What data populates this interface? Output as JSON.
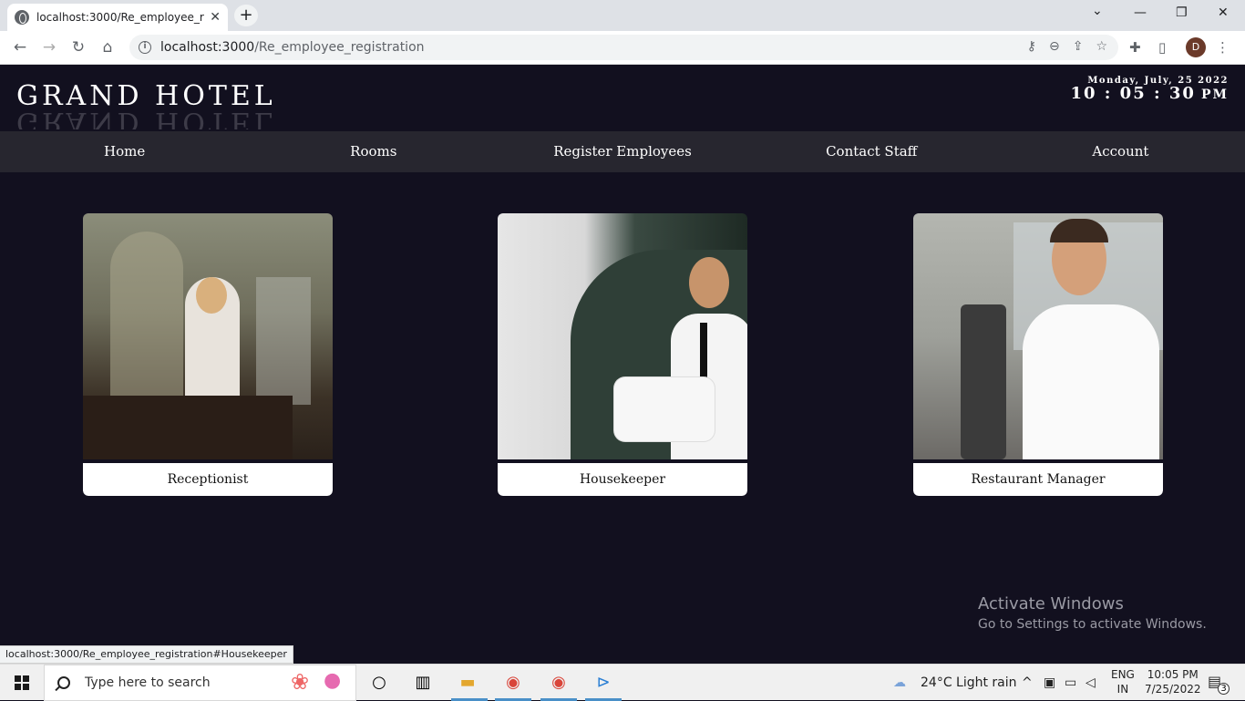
{
  "browser": {
    "tab_title": "localhost:3000/Re_employee_reg",
    "tab_close": "✕",
    "new_tab": "+",
    "url_host": "localhost:3000",
    "url_path": "/Re_employee_registration",
    "avatar_letter": "D",
    "minimize": "—",
    "restore": "❐",
    "close": "✕",
    "chevron": "⌄"
  },
  "site": {
    "brand": "GRAND HOTEL",
    "date": "Monday, July, 25 2022",
    "time": "10 : 05 : 30",
    "ampm": "PM"
  },
  "nav": [
    {
      "label": "Home"
    },
    {
      "label": "Rooms"
    },
    {
      "label": "Register Employees"
    },
    {
      "label": "Contact Staff"
    },
    {
      "label": "Account"
    }
  ],
  "cards": [
    {
      "label": "Receptionist"
    },
    {
      "label": "Housekeeper"
    },
    {
      "label": "Restaurant Manager"
    }
  ],
  "status_link": "localhost:3000/Re_employee_registration#Housekeeper",
  "watermark": {
    "title": "Activate Windows",
    "subtitle": "Go to Settings to activate Windows."
  },
  "taskbar": {
    "search_placeholder": "Type here to search",
    "weather": "24°C  Light rain",
    "lang_top": "ENG",
    "lang_bottom": "IN",
    "time": "10:05 PM",
    "date": "7/25/2022",
    "notifications": "3"
  },
  "colors": {
    "page_bg": "#12101f",
    "nav_bg": "#27262f",
    "accent": "#4a90c8"
  }
}
